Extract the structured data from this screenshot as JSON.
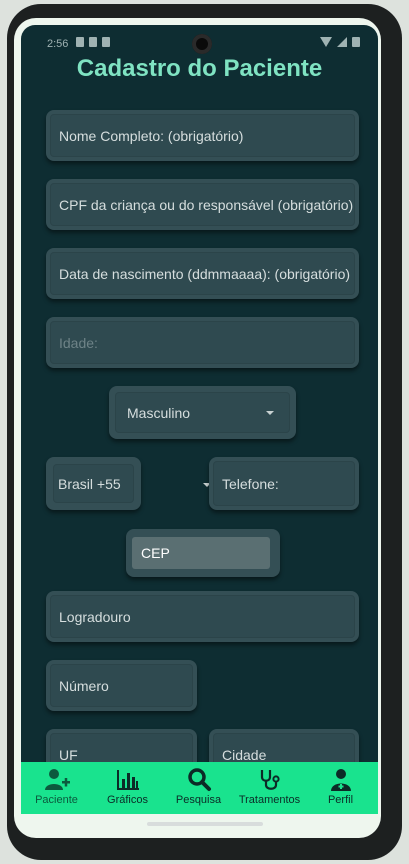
{
  "status_bar": {
    "time": "2:56"
  },
  "title": "Cadastro do Paciente",
  "fields": {
    "nome": "Nome Completo: (obrigatório)",
    "cpf": "CPF da criança ou do responsável (obrigatório)",
    "nascimento": "Data de nascimento (ddmmaaaa): (obrigatório)",
    "idade": "Idade:",
    "sexo": "Masculino",
    "pais": "Brasil +55",
    "telefone": "Telefone:",
    "cep": "CEP",
    "logradouro": "Logradouro",
    "numero": "Número",
    "uf": "UF",
    "cidade": "Cidade"
  },
  "nav": {
    "items": [
      {
        "label": "Paciente",
        "icon": "add-user-icon",
        "active": true
      },
      {
        "label": "Gráficos",
        "icon": "bar-chart-icon"
      },
      {
        "label": "Pesquisa",
        "icon": "search-icon"
      },
      {
        "label": "Tratamentos",
        "icon": "stethoscope-icon"
      },
      {
        "label": "Perfil",
        "icon": "doctor-icon"
      }
    ]
  },
  "colors": {
    "background": "#0e2d32",
    "title": "#7fe3c2",
    "nav_bar": "#19e38e",
    "field": "#344f55"
  }
}
